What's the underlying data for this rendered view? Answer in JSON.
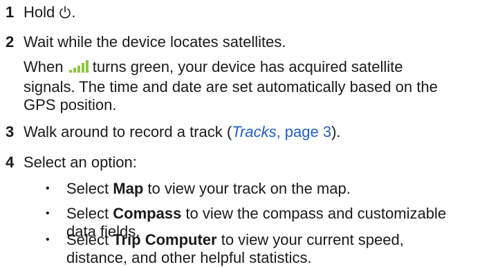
{
  "steps": [
    {
      "number": "1",
      "text_before_icon": "Hold ",
      "icon": "power-icon",
      "text_after_icon": "."
    },
    {
      "number": "2",
      "text": "Wait while the device locates satellites.",
      "note": {
        "prefix": "When ",
        "icon": "satellite-signal-icon",
        "suffix": " turns green, your device has acquired satellite",
        "line2": "signals. The time and date are set automatically based on the",
        "line3": "GPS position."
      }
    },
    {
      "number": "3",
      "text_before_link": "Walk around to record a track (",
      "link_italic": "Tracks",
      "link_rest": ", page 3",
      "text_after_link": ")."
    },
    {
      "number": "4",
      "text": "Select an option:",
      "options": [
        {
          "prefix": "Select ",
          "bold": "Map",
          "line1_suffix": " to view your track on the map.",
          "line2": ""
        },
        {
          "prefix": "Select ",
          "bold": "Compass",
          "line1_suffix": " to view the compass and customizable",
          "line2": "data fields."
        },
        {
          "prefix": "Select ",
          "bold": "Trip Computer",
          "line1_suffix": " to view your current speed,",
          "line2": "distance, and other helpful statistics."
        }
      ]
    }
  ],
  "colors": {
    "text": "#1a1a1a",
    "link": "#1f5fbf",
    "signal_bars": "#8dc63f"
  }
}
